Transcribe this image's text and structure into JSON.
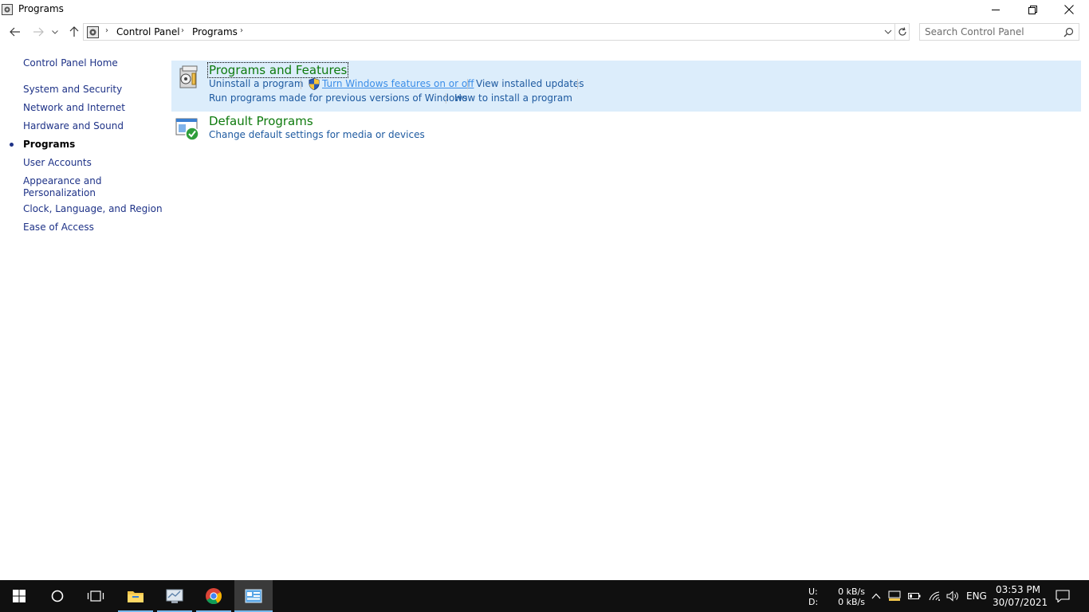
{
  "window": {
    "title": "Programs",
    "controls": {
      "minimize": "minimize",
      "restore": "restore",
      "close": "close"
    }
  },
  "address": {
    "crumbs": [
      "Control Panel",
      "Programs"
    ],
    "search_placeholder": "Search Control Panel"
  },
  "sidebar": {
    "items": [
      {
        "label": "Control Panel Home"
      },
      {
        "label": "System and Security"
      },
      {
        "label": "Network and Internet"
      },
      {
        "label": "Hardware and Sound"
      },
      {
        "label": "Programs",
        "current": true
      },
      {
        "label": "User Accounts"
      },
      {
        "label": "Appearance and"
      },
      {
        "label": "Personalization"
      },
      {
        "label": "Clock, Language, and Region"
      },
      {
        "label": "Ease of Access"
      }
    ]
  },
  "main": {
    "categories": [
      {
        "title": "Programs and Features",
        "links": [
          "Uninstall a program",
          "Turn Windows features on or off",
          "View installed updates",
          "Run programs made for previous versions of Windows",
          "How to install a program"
        ]
      },
      {
        "title": "Default Programs",
        "links": [
          "Change default settings for media or devices"
        ]
      }
    ]
  },
  "taskbar": {
    "net_upload_label": "U:",
    "net_download_label": "D:",
    "net_upload_value": "0 kB/s",
    "net_download_value": "0 kB/s",
    "language": "ENG",
    "time": "03:53 PM",
    "date": "30/07/2021",
    "accent_color": "#76b9ed"
  },
  "colors": {
    "link": "#1e5aa0",
    "category_title": "#0e7a0d",
    "highlight": "#dcedfb"
  }
}
